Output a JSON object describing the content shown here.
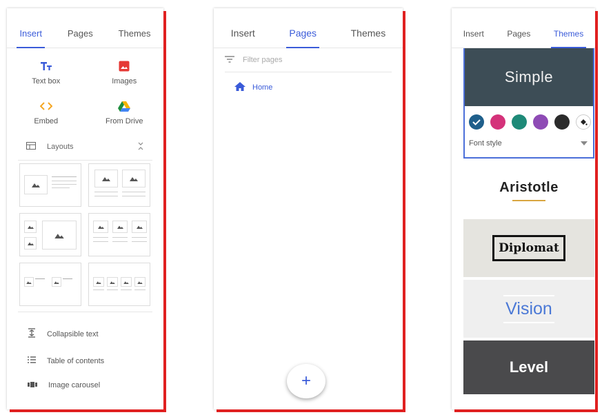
{
  "panel_insert": {
    "tabs": [
      "Insert",
      "Pages",
      "Themes"
    ],
    "active_tab": "Insert",
    "items": [
      {
        "label": "Text box",
        "icon": "text-box-icon",
        "color": "#3a5bd9"
      },
      {
        "label": "Images",
        "icon": "image-icon",
        "color": "#e53935"
      },
      {
        "label": "Embed",
        "icon": "embed-code-icon",
        "color": "#f5a623"
      },
      {
        "label": "From Drive",
        "icon": "google-drive-icon",
        "color": "#1e8e3e"
      }
    ],
    "layouts_label": "Layouts",
    "list": [
      {
        "label": "Collapsible text",
        "icon": "collapsible-text-icon"
      },
      {
        "label": "Table of contents",
        "icon": "table-of-contents-icon"
      },
      {
        "label": "Image carousel",
        "icon": "image-carousel-icon"
      }
    ]
  },
  "panel_pages": {
    "tabs": [
      "Insert",
      "Pages",
      "Themes"
    ],
    "active_tab": "Pages",
    "filter_placeholder": "Filter pages",
    "pages": [
      {
        "label": "Home",
        "icon": "home-icon"
      }
    ],
    "fab_label": "+"
  },
  "panel_themes": {
    "tabs": [
      "Insert",
      "Pages",
      "Themes"
    ],
    "active_tab": "Themes",
    "selected_theme": "Simple",
    "swatch_colors": [
      "#1f5f8b",
      "#d4327a",
      "#1e8a78",
      "#8e4bb5",
      "#2b2b2b"
    ],
    "font_style_label": "Font style",
    "themes": [
      "Aristotle",
      "Diplomat",
      "Vision",
      "Level"
    ]
  }
}
